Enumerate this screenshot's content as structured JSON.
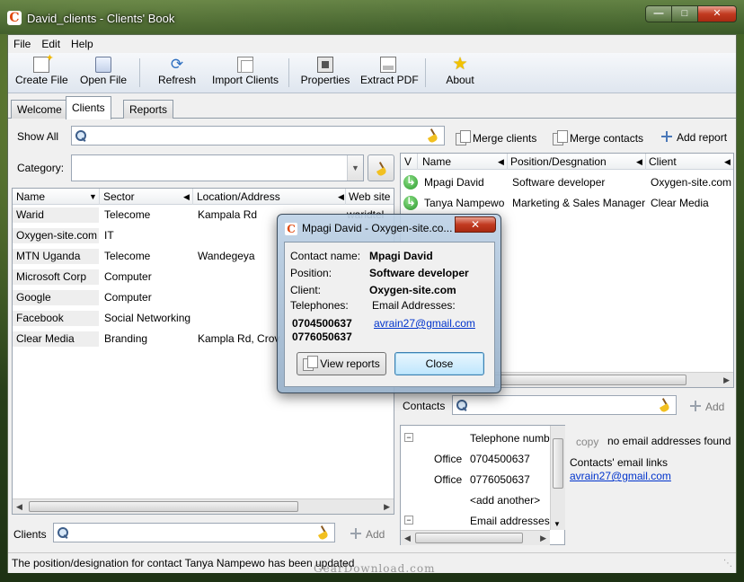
{
  "window": {
    "title": "David_clients - Clients' Book",
    "app_icon": "C"
  },
  "menu": [
    "File",
    "Edit",
    "Help"
  ],
  "toolbar": [
    {
      "label": "Create File",
      "icon": "new-file-icon"
    },
    {
      "label": "Open File",
      "icon": "open-file-icon"
    },
    {
      "label": "Refresh",
      "icon": "refresh-icon"
    },
    {
      "label": "Import Clients",
      "icon": "import-icon"
    },
    {
      "label": "Properties",
      "icon": "properties-icon"
    },
    {
      "label": "Extract PDF",
      "icon": "printer-icon"
    },
    {
      "label": "About",
      "icon": "star-icon"
    }
  ],
  "tabs": [
    {
      "label": "Welcome",
      "active": false
    },
    {
      "label": "Clients",
      "active": true
    },
    {
      "label": "Reports",
      "active": false
    }
  ],
  "left": {
    "show_all": "Show All",
    "category_label": "Category:",
    "columns": [
      "Name",
      "Sector",
      "Location/Address",
      "Web site"
    ],
    "rows": [
      {
        "name": "Warid",
        "sector": "Telecome",
        "location": "Kampala Rd",
        "web": "waridtel"
      },
      {
        "name": "Oxygen-site.com",
        "sector": "IT",
        "location": "",
        "web": ""
      },
      {
        "name": "MTN  Uganda",
        "sector": "Telecome",
        "location": "Wandegeya",
        "web": ""
      },
      {
        "name": "Microsoft Corp",
        "sector": "Computer",
        "location": "",
        "web": ""
      },
      {
        "name": "Google",
        "sector": "Computer",
        "location": "",
        "web": ""
      },
      {
        "name": "Facebook",
        "sector": "Social Networking",
        "location": "",
        "web": ""
      },
      {
        "name": "Clear Media",
        "sector": "Branding",
        "location": "Kampla Rd, Crov",
        "web": ""
      }
    ],
    "clients_label": "Clients",
    "add_label": "Add"
  },
  "right": {
    "merge_clients": "Merge clients",
    "merge_contacts": "Merge contacts",
    "add_report": "Add report",
    "columns": [
      "V",
      "Name",
      "Position/Desgnation",
      "Client"
    ],
    "rows": [
      {
        "name": "Mpagi David",
        "position": "Software  developer",
        "client": "Oxygen-site.com"
      },
      {
        "name": "Tanya Nampewo",
        "position": "Marketing & Sales Manager",
        "client": "Clear Media"
      }
    ],
    "contacts_label": "Contacts",
    "add_label": "Add",
    "tree": {
      "telephone_header": "Telephone numb",
      "phones": [
        {
          "type": "Office",
          "number": "0704500637"
        },
        {
          "type": "Office",
          "number": "0776050637"
        }
      ],
      "add_another": "<add another>",
      "email_header": "Email addresses"
    },
    "copy_label": "copy",
    "no_email": "no email addresses found",
    "email_links_label": "Contacts' email links",
    "email_link": "avrain27@gmail.com"
  },
  "dialog": {
    "title": "Mpagi David - Oxygen-site.co...",
    "contact_name_label": "Contact name:",
    "contact_name": "Mpagi David",
    "position_label": "Position:",
    "position": "Software  developer",
    "client_label": "Client:",
    "client": "Oxygen-site.com",
    "telephones_label": "Telephones:",
    "emails_label": "Email Addresses:",
    "phones": [
      "0704500637",
      "0776050637"
    ],
    "email": "avrain27@gmail.com",
    "view_reports": "View reports",
    "close": "Close"
  },
  "status": "The position/designation for contact Tanya Nampewo has been updated",
  "watermark": "GearDownload.com"
}
